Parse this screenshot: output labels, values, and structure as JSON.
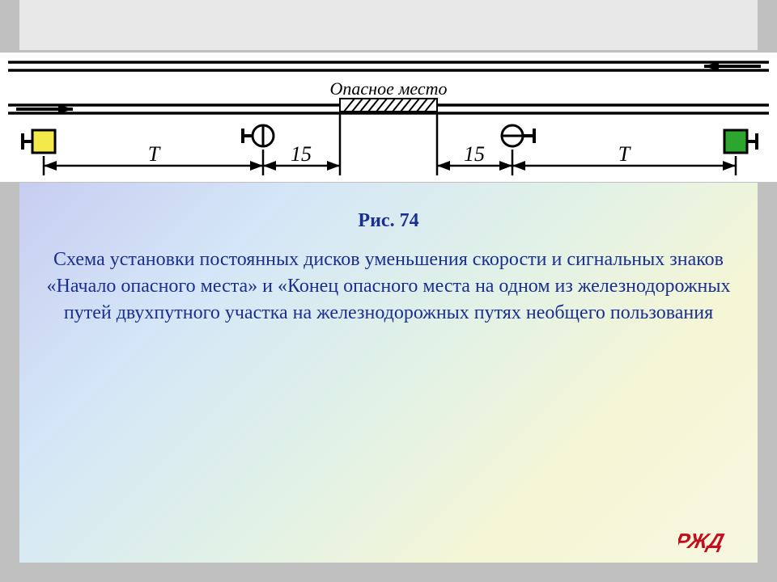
{
  "diagram": {
    "danger_label": "Опасное место",
    "dims": {
      "left_outer": "Т",
      "left_inner": "15",
      "right_inner": "15",
      "right_outer": "Т"
    },
    "signals": {
      "left_square_color": "#f3e94b",
      "right_square_color": "#2da62f"
    }
  },
  "caption": {
    "title": "Рис. 74",
    "text": "Схема установки постоянных дисков уменьшения скорости и сигнальных знаков «Начало опасного места» и «Конец опасного места на одном из железнодорожных путей двухпутного участка на железнодорожных путях необщего пользования"
  },
  "logo_text": "РЖД"
}
